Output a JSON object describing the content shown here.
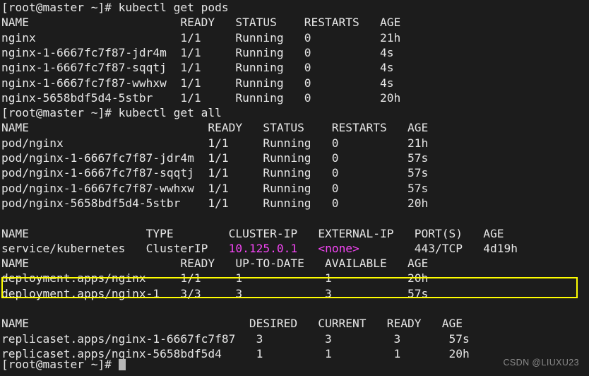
{
  "terminal": {
    "background_color": "#1c1c1c",
    "foreground_color": "#e6e6e6",
    "accent_color": "#f545f5",
    "annotation_color": "#ffff00",
    "prompt": "[root@master ~]#",
    "lines": {
      "l01": "[root@master ~]# kubectl get pods",
      "l02": "NAME                      READY   STATUS    RESTARTS   AGE",
      "l03": "nginx                     1/1     Running   0          21h",
      "l04": "nginx-1-6667fc7f87-jdr4m  1/1     Running   0          4s",
      "l05": "nginx-1-6667fc7f87-sqqtj  1/1     Running   0          4s",
      "l06": "nginx-1-6667fc7f87-wwhxw  1/1     Running   0          4s",
      "l07": "nginx-5658bdf5d4-5stbr    1/1     Running   0          20h",
      "l08": "[root@master ~]# kubectl get all",
      "l09": "NAME                          READY   STATUS    RESTARTS   AGE",
      "l10": "pod/nginx                     1/1     Running   0          21h",
      "l11": "pod/nginx-1-6667fc7f87-jdr4m  1/1     Running   0          57s",
      "l12": "pod/nginx-1-6667fc7f87-sqqtj  1/1     Running   0          57s",
      "l13": "pod/nginx-1-6667fc7f87-wwhxw  1/1     Running   0          57s",
      "l14": "pod/nginx-5658bdf5d4-5stbr    1/1     Running   0          20h",
      "l16_a": "NAME                 TYPE        ",
      "l16_b": "CLUSTER-IP   ",
      "l16_c": "EXTERNAL-IP   PORT(S)   AGE",
      "l17_a": "service/kubernetes   ClusterIP   ",
      "l17_ip": "10.125.0.1",
      "l17_b": "   ",
      "l17_none": "<none>",
      "l17_c": "        443/TCP   4d19h",
      "l19": "NAME                      READY   UP-TO-DATE   AVAILABLE   AGE",
      "l20": "deployment.apps/nginx     1/1     1            1           20h",
      "l21": "deployment.apps/nginx-1   3/3     3            3           57s",
      "l23": "NAME                                DESIRED   CURRENT   READY   AGE",
      "l24": "replicaset.apps/nginx-1-6667fc7f87   3         3         3       57s",
      "l25": "replicaset.apps/nginx-5658bdf5d4     1         1         1       20h",
      "l26": "[root@master ~]# "
    }
  },
  "watermark": {
    "text": "CSDN @LIUXU23"
  }
}
